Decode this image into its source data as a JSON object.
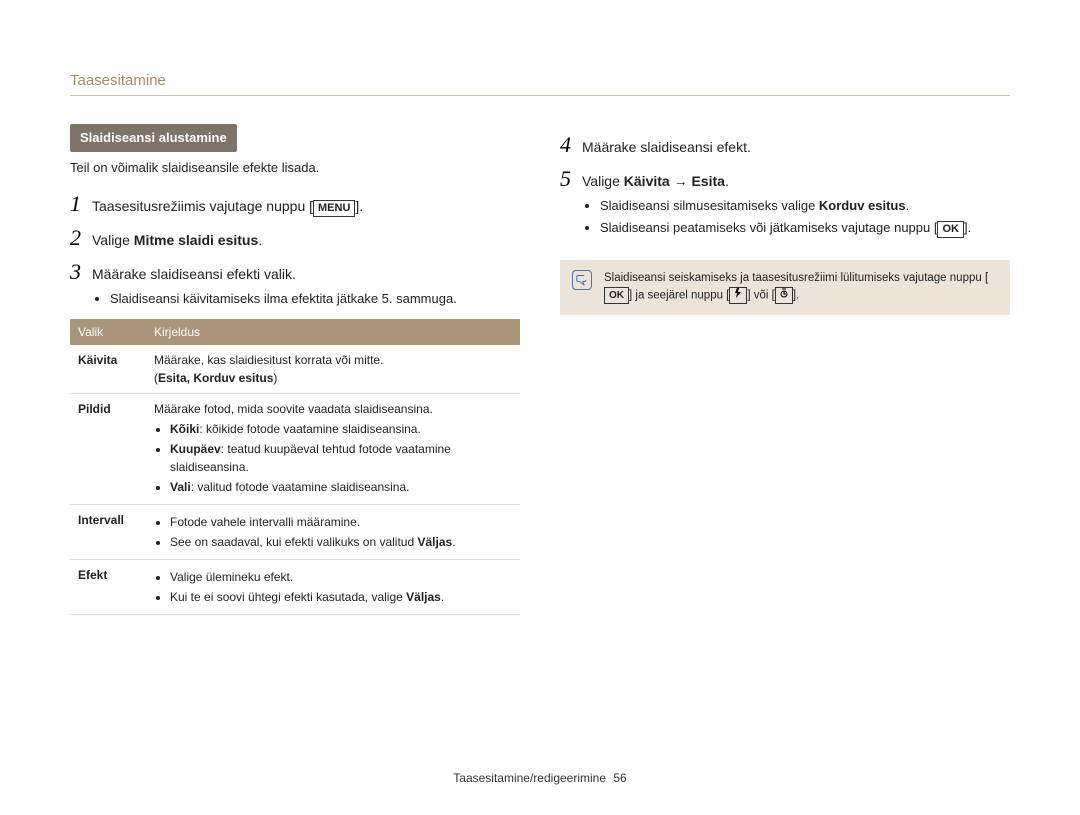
{
  "header": {
    "title": "Taasesitamine"
  },
  "left": {
    "pill": "Slaidiseansi alustamine",
    "intro": "Teil on võimalik slaidiseansile efekte lisada.",
    "step1_pre": "Taasesitusrežiimis vajutage nuppu [",
    "step1_btn": "MENU",
    "step1_post": "].",
    "step2_pre": "Valige ",
    "step2_bold": "Mitme slaidi esitus",
    "step2_post": ".",
    "step3": "Määrake slaidiseansi efekti valik.",
    "step3_bullet": "Slaidiseansi käivitamiseks ilma efektita jätkake 5. sammuga.",
    "table": {
      "h1": "Valik",
      "h2": "Kirjeldus",
      "rows": [
        {
          "name": "Käivita",
          "desc_line": "Määrake, kas slaidiesitust korrata või mitte.",
          "desc_paren_pre": "(",
          "desc_paren_bold": "Esita, Korduv esitus",
          "desc_paren_post": ")"
        },
        {
          "name": "Pildid",
          "desc_line": "Määrake fotod, mida soovite vaadata slaidiseansina.",
          "items": [
            {
              "b": "Kõiki",
              "t": ": kõikide fotode vaatamine slaidiseansina."
            },
            {
              "b": "Kuupäev",
              "t": ": teatud kuupäeval tehtud fotode vaatamine slaidiseansina."
            },
            {
              "b": "Vali",
              "t": ": valitud fotode vaatamine slaidiseansina."
            }
          ]
        },
        {
          "name": "Intervall",
          "items_plain": [
            "Fotode vahele intervalli määramine.",
            "See on saadaval, kui efekti valikuks on valitud "
          ],
          "trailing_bold": "Väljas",
          "trailing_post": "."
        },
        {
          "name": "Efekt",
          "items": [
            {
              "t": "Valige ülemineku efekt."
            },
            {
              "t_pre": "Kui te ei soovi ühtegi efekti kasutada, valige ",
              "b": "Väljas",
              "t_post": "."
            }
          ]
        }
      ]
    }
  },
  "right": {
    "step4": "Määrake slaidiseansi efekt.",
    "step5_pre": "Valige ",
    "step5_bold": "Käivita → Esita",
    "step5_post": ".",
    "b1_pre": "Slaidiseansi silmusesitamiseks valige ",
    "b1_bold": "Korduv esitus",
    "b1_post": ".",
    "b2_pre": "Slaidiseansi peatamiseks või jätkamiseks vajutage nuppu [",
    "b2_btn": "OK",
    "b2_post": "].",
    "note_pre": "Slaidiseansi seiskamiseks ja taasesitusrežiimi lülitumiseks vajutage nuppu [",
    "note_btn": "OK",
    "note_mid": "] ja seejärel nuppu [",
    "note_icon1": "flash-icon",
    "note_between": "] või [",
    "note_icon2": "timer-icon",
    "note_end": "]."
  },
  "footer": {
    "text": "Taasesitamine/redigeerimine",
    "page": "56"
  }
}
